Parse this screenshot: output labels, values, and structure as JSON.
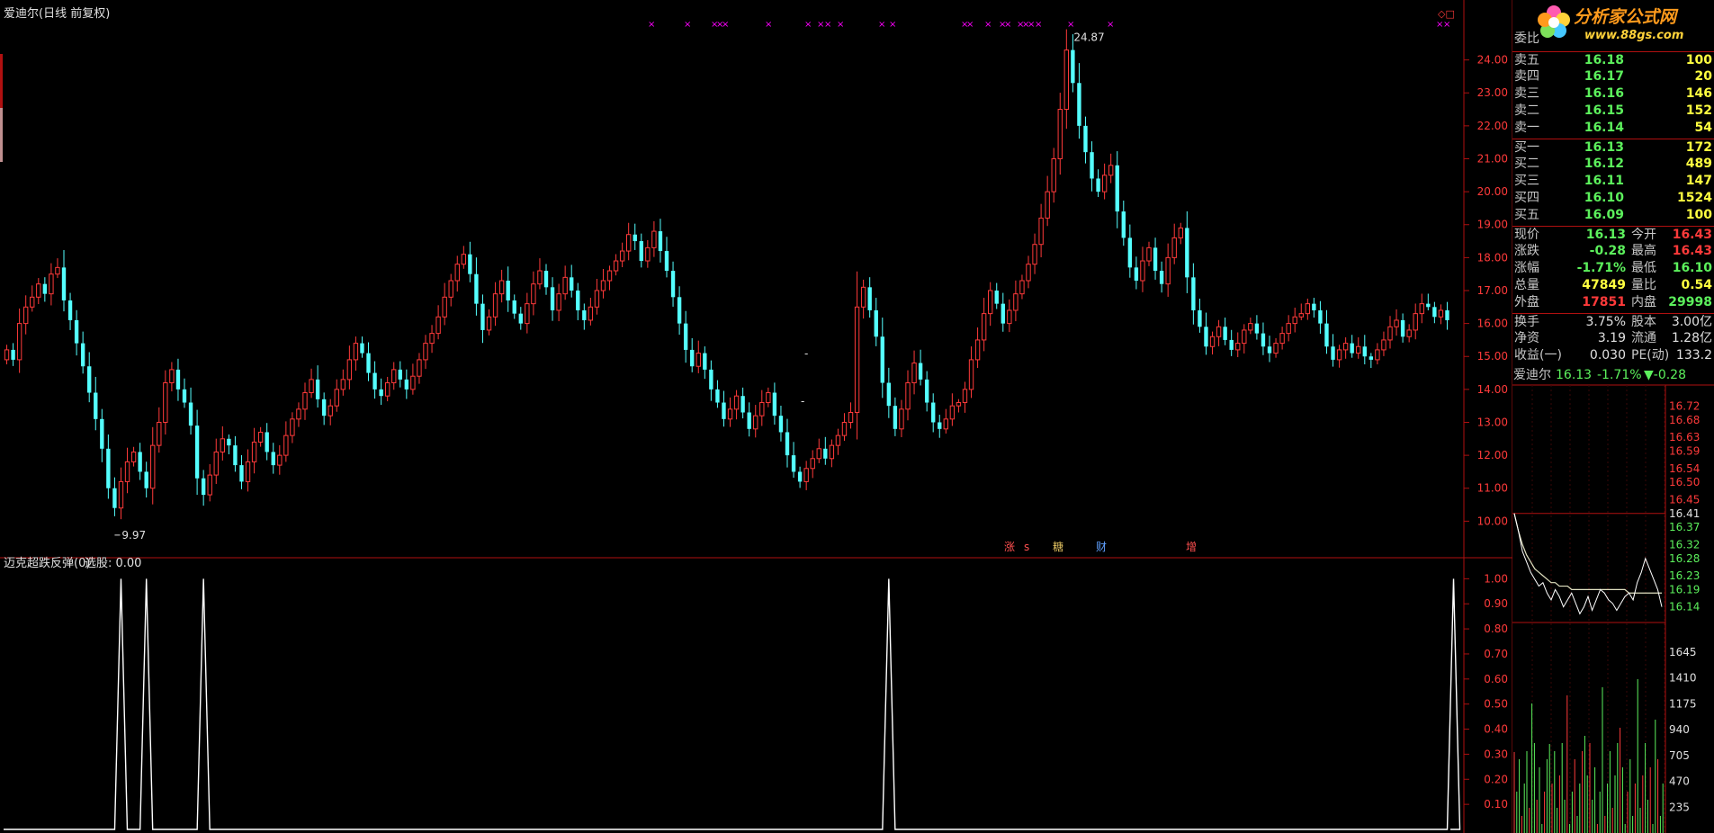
{
  "main_title": "爱迪尔(日线 前复权)",
  "indicator_title": "迈克超跌反弹(0)",
  "indicator_value_label": "选股: 0.00",
  "high_label": "24.87",
  "low_label": "9.97",
  "event_markers": [
    "涨",
    "s",
    "糖",
    "财",
    "增"
  ],
  "top_right_glyph": "◇□",
  "logo": {
    "text": "分析家公式网",
    "url": "www.88gs.com"
  },
  "colors": {
    "up": "#ff3a3a",
    "down": "#54ffff",
    "axis": "#b01010",
    "signal": "#ffffff",
    "marker": "#ff00ff",
    "flat": "#ffffff"
  },
  "chart_data": [
    {
      "type": "candlestick",
      "title": "爱迪尔(日线 前复权)",
      "yticks": [
        "24.00",
        "23.00",
        "22.00",
        "21.00",
        "20.00",
        "19.00",
        "18.00",
        "17.00",
        "16.00",
        "15.00",
        "14.00",
        "13.00",
        "12.00",
        "11.00",
        "10.00"
      ],
      "ylim": [
        9.3,
        25.0
      ],
      "closes": [
        15.2,
        14.9,
        16.0,
        16.5,
        16.8,
        17.2,
        16.9,
        17.5,
        17.7,
        16.7,
        16.1,
        15.4,
        14.7,
        13.9,
        13.1,
        12.2,
        11.0,
        10.4,
        11.2,
        11.8,
        12.1,
        11.5,
        11.0,
        12.3,
        13.0,
        14.2,
        14.6,
        14.0,
        13.6,
        12.9,
        11.3,
        10.8,
        11.4,
        12.1,
        12.5,
        12.3,
        11.7,
        11.2,
        11.8,
        12.4,
        12.7,
        12.1,
        11.7,
        12.0,
        12.6,
        13.1,
        13.4,
        13.9,
        14.3,
        13.7,
        13.2,
        13.5,
        14.0,
        14.3,
        14.9,
        15.4,
        15.1,
        14.5,
        14.0,
        13.8,
        14.2,
        14.6,
        14.3,
        14.0,
        14.4,
        14.9,
        15.4,
        15.7,
        16.2,
        16.8,
        17.3,
        17.8,
        18.1,
        17.5,
        16.6,
        15.8,
        16.2,
        16.9,
        17.3,
        16.7,
        16.3,
        16.0,
        16.6,
        17.2,
        17.6,
        17.1,
        16.4,
        16.9,
        17.4,
        17.0,
        16.4,
        16.1,
        16.5,
        17.0,
        17.3,
        17.6,
        17.9,
        18.2,
        18.7,
        18.5,
        17.9,
        18.3,
        18.8,
        18.2,
        17.6,
        16.8,
        16.0,
        15.2,
        14.7,
        15.1,
        14.6,
        14.0,
        13.6,
        13.1,
        13.4,
        13.8,
        13.3,
        12.8,
        13.2,
        13.6,
        13.9,
        13.2,
        12.7,
        12.0,
        11.5,
        11.2,
        11.6,
        11.9,
        12.2,
        11.9,
        12.3,
        12.6,
        13.0,
        13.3,
        16.5,
        17.1,
        16.4,
        15.6,
        14.2,
        13.5,
        12.8,
        13.4,
        14.2,
        14.8,
        14.3,
        13.6,
        13.0,
        12.8,
        13.1,
        13.5,
        13.6,
        14.0,
        14.9,
        15.5,
        16.3,
        17.0,
        16.6,
        16.0,
        16.4,
        16.9,
        17.3,
        17.8,
        18.4,
        19.2,
        20.0,
        21.0,
        22.5,
        24.3,
        23.3,
        22.0,
        21.2,
        20.4,
        20.0,
        20.5,
        20.8,
        19.4,
        18.6,
        17.7,
        17.3,
        17.9,
        18.3,
        17.6,
        17.2,
        18.0,
        18.6,
        18.9,
        17.4,
        16.4,
        15.9,
        15.3,
        15.6,
        15.9,
        15.5,
        15.2,
        15.4,
        15.8,
        16.0,
        15.7,
        15.3,
        15.1,
        15.4,
        15.7,
        16.0,
        16.2,
        16.3,
        16.6,
        16.4,
        16.0,
        15.3,
        14.9,
        15.2,
        15.4,
        15.1,
        15.3,
        15.0,
        14.9,
        15.2,
        15.5,
        15.9,
        16.1,
        15.6,
        15.8,
        16.3,
        16.6,
        16.5,
        16.2,
        16.4,
        16.1
      ]
    },
    {
      "type": "line",
      "title": "迈克超跌反弹(0)",
      "yticks": [
        "1.00",
        "0.90",
        "0.80",
        "0.70",
        "0.60",
        "0.50",
        "0.40",
        "0.30",
        "0.20",
        "0.10"
      ],
      "ylim": [
        0,
        1.03
      ],
      "signal_indices": [
        18,
        22,
        31,
        139,
        228
      ],
      "value": 0.0
    },
    {
      "type": "line",
      "title": "爱迪尔 分时",
      "price_ticks_left_red": [
        "16.72",
        "16.68",
        "16.63",
        "16.59",
        "16.54",
        "16.50",
        "16.45"
      ],
      "price_tick_center": "16.41",
      "price_ticks_left_green": [
        "16.37",
        "16.32",
        "16.28",
        "16.23",
        "16.19",
        "16.14"
      ],
      "volume_ticks": [
        "1645",
        "1410",
        "1175",
        "940",
        "705",
        "470",
        "235"
      ],
      "ylim": [
        16.1,
        16.75
      ],
      "prices": [
        16.41,
        16.36,
        16.3,
        16.27,
        16.24,
        16.22,
        16.2,
        16.21,
        16.18,
        16.16,
        16.19,
        16.17,
        16.14,
        16.16,
        16.18,
        16.15,
        16.12,
        16.14,
        16.17,
        16.13,
        16.16,
        16.19,
        16.18,
        16.16,
        16.15,
        16.13,
        16.15,
        16.17,
        16.18,
        16.16,
        16.21,
        16.24,
        16.28,
        16.25,
        16.22,
        16.19,
        16.14
      ],
      "avg": [
        16.41,
        16.36,
        16.32,
        16.29,
        16.27,
        16.25,
        16.24,
        16.23,
        16.22,
        16.21,
        16.21,
        16.2,
        16.2,
        16.2,
        16.19,
        16.19,
        16.19,
        16.19,
        16.19,
        16.19,
        16.19,
        16.19,
        16.19,
        16.19,
        16.19,
        16.19,
        16.19,
        16.19,
        16.18,
        16.18,
        16.18,
        16.18,
        16.18,
        16.18,
        16.18,
        16.18,
        16.18
      ]
    }
  ],
  "quote": {
    "header": "委比",
    "sell": [
      {
        "label": "卖五",
        "price": "16.18",
        "vol": "100"
      },
      {
        "label": "卖四",
        "price": "16.17",
        "vol": "20"
      },
      {
        "label": "卖三",
        "price": "16.16",
        "vol": "146"
      },
      {
        "label": "卖二",
        "price": "16.15",
        "vol": "152"
      },
      {
        "label": "卖一",
        "price": "16.14",
        "vol": "54"
      }
    ],
    "buy": [
      {
        "label": "买一",
        "price": "16.13",
        "vol": "172"
      },
      {
        "label": "买二",
        "price": "16.12",
        "vol": "489"
      },
      {
        "label": "买三",
        "price": "16.11",
        "vol": "147"
      },
      {
        "label": "买四",
        "price": "16.10",
        "vol": "1524"
      },
      {
        "label": "买五",
        "price": "16.09",
        "vol": "100"
      }
    ],
    "stats": [
      {
        "l1": "现价",
        "v1": "16.13",
        "c1": "#5cf05c",
        "l2": "今开",
        "v2": "16.43",
        "c2": "#ff3a3a"
      },
      {
        "l1": "涨跌",
        "v1": "-0.28",
        "c1": "#5cf05c",
        "l2": "最高",
        "v2": "16.43",
        "c2": "#ff3a3a"
      },
      {
        "l1": "涨幅",
        "v1": "-1.71%",
        "c1": "#5cf05c",
        "l2": "最低",
        "v2": "16.10",
        "c2": "#5cf05c"
      },
      {
        "l1": "总量",
        "v1": "47849",
        "c1": "#ffff40",
        "l2": "量比",
        "v2": "0.54",
        "c2": "#ffff40"
      },
      {
        "l1": "外盘",
        "v1": "17851",
        "c1": "#ff3a3a",
        "l2": "内盘",
        "v2": "29998",
        "c2": "#5cf05c"
      }
    ],
    "stats2": [
      {
        "l1": "换手",
        "v1": "3.75%",
        "l2": "股本",
        "v2": "3.00亿"
      },
      {
        "l1": "净资",
        "v1": "3.19",
        "l2": "流通",
        "v2": "1.28亿"
      },
      {
        "l1": "收益(一)",
        "v1": "0.030",
        "l2": "PE(动)",
        "v2": "133.2"
      }
    ]
  },
  "mini_header": {
    "name": "爱迪尔",
    "price": "16.13",
    "pct": "-1.71%",
    "change": "▼-0.28"
  }
}
